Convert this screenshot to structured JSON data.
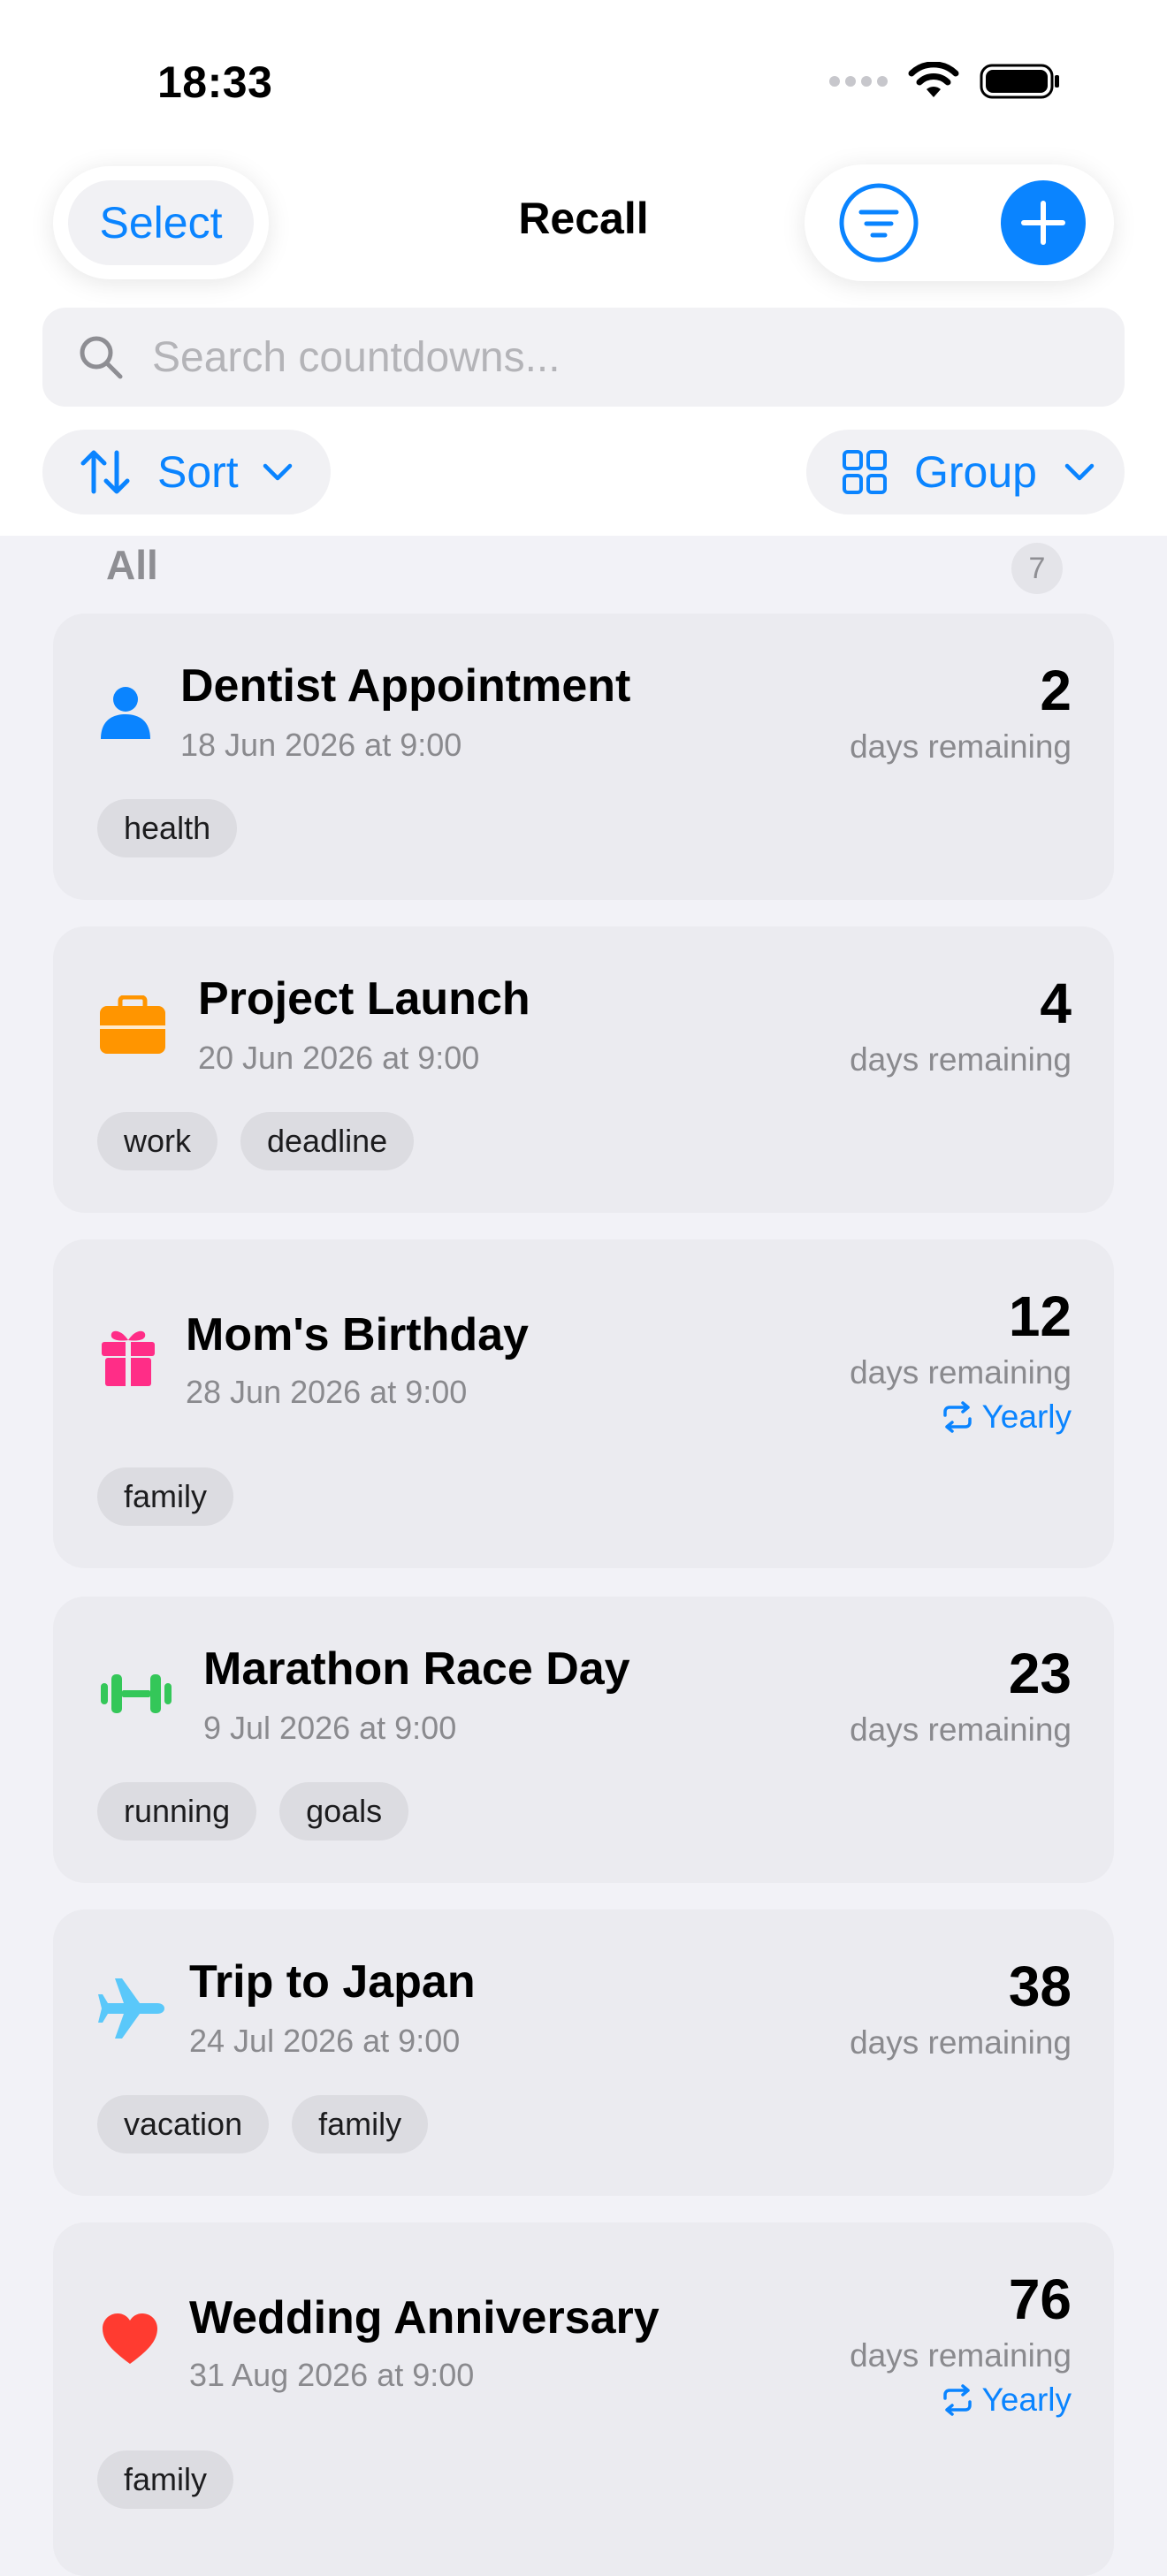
{
  "status_bar": {
    "time": "18:33"
  },
  "nav": {
    "select_label": "Select",
    "title": "Recall",
    "filter_icon": "filter-lines-circle-icon",
    "add_icon": "plus-icon"
  },
  "search": {
    "placeholder": "Search countdowns..."
  },
  "toolbar": {
    "sort_label": "Sort",
    "group_label": "Group"
  },
  "section": {
    "title": "All",
    "count": "7"
  },
  "colors": {
    "accent": "#0a84ff",
    "card": "#ebebf0",
    "tag": "#dcdce1"
  },
  "countdowns": [
    {
      "title": "Dentist Appointment",
      "date": "18 Jun 2026 at 9:00",
      "days": "2",
      "remaining": "days remaining",
      "tags": [
        "health"
      ],
      "icon": "person-icon",
      "color": "#0a84ff"
    },
    {
      "title": "Project Launch",
      "date": "20 Jun 2026 at 9:00",
      "days": "4",
      "remaining": "days remaining",
      "tags": [
        "work",
        "deadline"
      ],
      "icon": "briefcase-icon",
      "color": "#ff9500"
    },
    {
      "title": "Mom's Birthday",
      "date": "28 Jun 2026 at 9:00",
      "days": "12",
      "remaining": "days remaining",
      "repeat": "Yearly",
      "tags": [
        "family"
      ],
      "icon": "gift-icon",
      "color": "#ff2d87"
    },
    {
      "title": "Marathon Race Day",
      "date": "9 Jul 2026 at 9:00",
      "days": "23",
      "remaining": "days remaining",
      "tags": [
        "running",
        "goals"
      ],
      "icon": "dumbbell-icon",
      "color": "#34c759"
    },
    {
      "title": "Trip to Japan",
      "date": "24 Jul 2026 at 9:00",
      "days": "38",
      "remaining": "days remaining",
      "tags": [
        "vacation",
        "family"
      ],
      "icon": "airplane-icon",
      "color": "#5ac8fa"
    },
    {
      "title": "Wedding Anniversary",
      "date": "31 Aug 2026 at 9:00",
      "days": "76",
      "remaining": "days remaining",
      "repeat": "Yearly",
      "tags": [
        "family"
      ],
      "icon": "heart-icon",
      "color": "#ff3b30"
    }
  ]
}
